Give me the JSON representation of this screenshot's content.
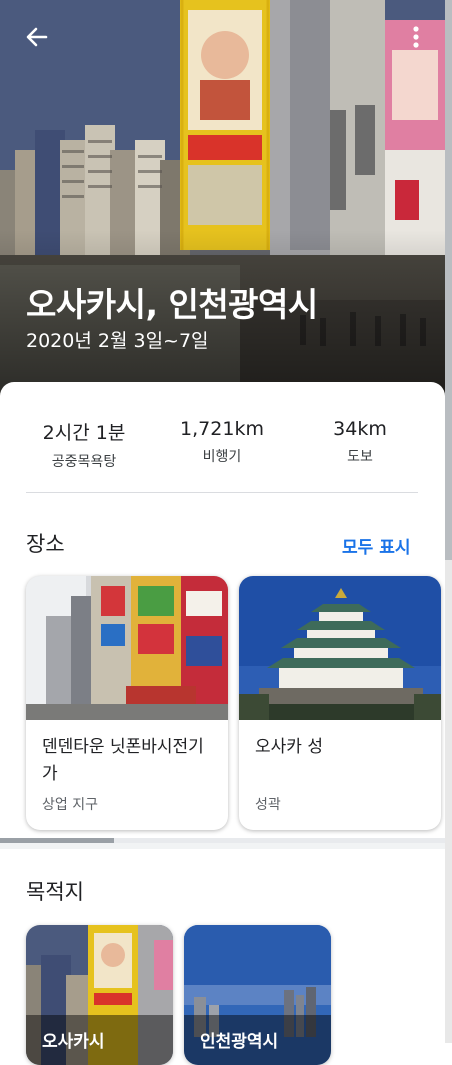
{
  "hero": {
    "title": "오사카시, 인천광역시",
    "dates": "2020년 2월 3일~7일"
  },
  "icons": {
    "back": "arrow-back-icon",
    "more": "more-vert-icon"
  },
  "stats": [
    {
      "value": "2시간 1분",
      "label": "공중목욕탕"
    },
    {
      "value": "1,721km",
      "label": "비행기"
    },
    {
      "value": "34km",
      "label": "도보"
    }
  ],
  "places": {
    "title": "장소",
    "show_all": "모두 표시",
    "items": [
      {
        "name": "덴덴타운 닛폰바시전기가",
        "category": "상업 지구"
      },
      {
        "name": "오사카 성",
        "category": "성곽"
      }
    ]
  },
  "destinations": {
    "title": "목적지",
    "items": [
      {
        "name": "오사카시"
      },
      {
        "name": "인천광역시"
      }
    ]
  },
  "colors": {
    "accent": "#1a73e8",
    "text_primary": "#202124",
    "text_secondary": "#5f6368"
  }
}
